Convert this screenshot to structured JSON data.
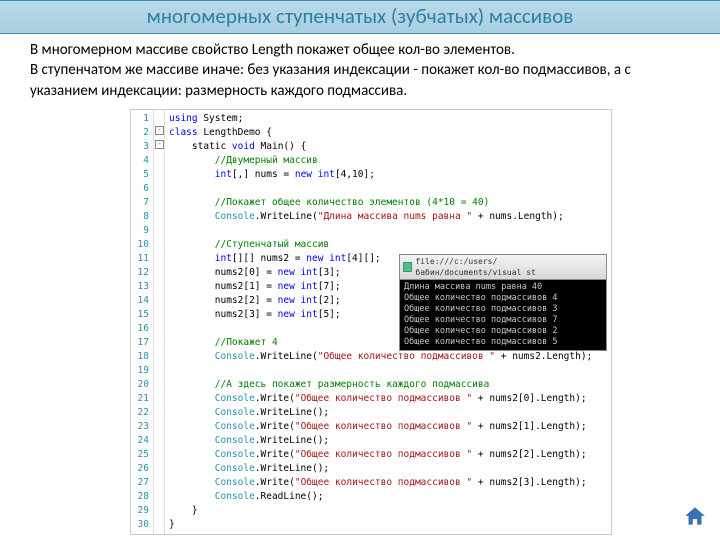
{
  "title": "многомерных ступенчатых (зубчатых) массивов",
  "para1": "В многомерном массиве свойство Length покажет общее кол-во элементов.",
  "para2": "В ступенчатом же массиве иначе: без указания индексации - покажет кол-во подмассивов, а с указанием индексации: размерность каждого подмассива.",
  "code": {
    "l1a": "using",
    "l1b": " System;",
    "l2a": "class",
    "l2b": " LengthDemo {",
    "l3a": "    static ",
    "l3b": "void",
    "l3c": " Main() {",
    "l4": "        //Двумерный массив",
    "l5a": "        int",
    "l5b": "[,] nums = ",
    "l5c": "new int",
    "l5d": "[4,10];",
    "l6": " ",
    "l7": "        //Покажет общее количество элементов (4*10 = 40)",
    "l8a": "        Console",
    "l8b": ".WriteLine(",
    "l8c": "\"Длина массива nums равна \"",
    "l8d": " + nums.Length);",
    "l9": " ",
    "l10": "        //Ступенчатый массив",
    "l11a": "        int",
    "l11b": "[][] nums2 = ",
    "l11c": "new int",
    "l11d": "[4][];",
    "l12a": "        nums2[0] = ",
    "l12b": "new int",
    "l12c": "[3];",
    "l13a": "        nums2[1] = ",
    "l13b": "new int",
    "l13c": "[7];",
    "l14a": "        nums2[2] = ",
    "l14b": "new int",
    "l14c": "[2];",
    "l15a": "        nums2[3] = ",
    "l15b": "new int",
    "l15c": "[5];",
    "l16": " ",
    "l17": "        //Покажет 4",
    "l18a": "        Console",
    "l18b": ".WriteLine(",
    "l18c": "\"Общее количество подмассивов \"",
    "l18d": " + nums2.Length);",
    "l19": " ",
    "l20": "        //А здесь покажет размерность каждого подмассива",
    "l21a": "        Console",
    "l21b": ".Write(",
    "l21c": "\"Общее количество подмассивов \"",
    "l21d": " + nums2[0].Length);",
    "l22a": "        Console",
    "l22b": ".WriteLine();",
    "l23a": "        Console",
    "l23b": ".Write(",
    "l23c": "\"Общее количество подмассивов \"",
    "l23d": " + nums2[1].Length);",
    "l24a": "        Console",
    "l24b": ".WriteLine();",
    "l25a": "        Console",
    "l25b": ".Write(",
    "l25c": "\"Общее количество подмассивов \"",
    "l25d": " + nums2[2].Length);",
    "l26a": "        Console",
    "l26b": ".WriteLine();",
    "l27a": "        Console",
    "l27b": ".Write(",
    "l27c": "\"Общее количество подмассивов \"",
    "l27d": " + nums2[3].Length);",
    "l28a": "        Console",
    "l28b": ".ReadLine();",
    "l29": "    }",
    "l30": "}"
  },
  "consoleTitle": "file:///c:/users/бабин/documents/visual st",
  "out": {
    "o1": "Длина массива nums равна 40",
    "o2": "Общее количество подмассивов 4",
    "o3": "Общее количество подмассивов 3",
    "o4": "Общее количество подмассивов 7",
    "o5": "Общее количество подмассивов 2",
    "o6": "Общее количество подмассивов 5"
  }
}
